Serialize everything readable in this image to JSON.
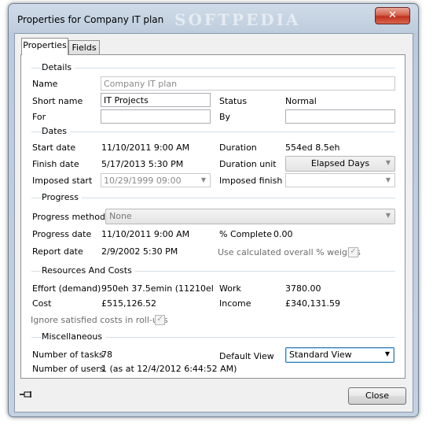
{
  "window": {
    "title": "Properties for Company IT plan",
    "watermark": "SOFTPEDIA",
    "close_glyph": "✕"
  },
  "tabs": [
    {
      "label": "Properties",
      "active": true
    },
    {
      "label": "Fields",
      "active": false
    }
  ],
  "details": {
    "header": "Details",
    "name_label": "Name",
    "name_value": "Company IT plan",
    "short_name_label": "Short name",
    "short_name_value": "IT Projects",
    "status_label": "Status",
    "status_value": "Normal",
    "for_label": "For",
    "for_value": "",
    "by_label": "By",
    "by_value": ""
  },
  "dates": {
    "header": "Dates",
    "start_label": "Start date",
    "start_value": "11/10/2011 9:00 AM",
    "duration_label": "Duration",
    "duration_value": "554ed 8.5eh",
    "finish_label": "Finish date",
    "finish_value": "5/17/2013 5:30 PM",
    "duration_unit_label": "Duration unit",
    "duration_unit_value": "Elapsed Days",
    "imposed_start_label": "Imposed start",
    "imposed_start_value": "10/29/1999 09:00",
    "imposed_finish_label": "Imposed finish",
    "imposed_finish_value": ""
  },
  "progress": {
    "header": "Progress",
    "method_label": "Progress method",
    "method_value": "None",
    "date_label": "Progress date",
    "date_value": "11/10/2011 9:00 AM",
    "complete_label": "% Complete",
    "complete_value": "0.00",
    "report_label": "Report date",
    "report_value": "2/9/2002 5:30 PM",
    "calc_weights_label": "Use calculated overall % weights",
    "calc_weights_checked": true
  },
  "resources": {
    "header": "Resources And Costs",
    "effort_label": "Effort (demand)",
    "effort_value": "950eh 37.5emin (11210el",
    "work_label": "Work",
    "work_value": "3780.00",
    "cost_label": "Cost",
    "cost_value": "£515,126.52",
    "income_label": "Income",
    "income_value": "£340,131.59",
    "ignore_label": "Ignore satisfied costs in roll-ups",
    "ignore_checked": true
  },
  "misc": {
    "header": "Miscellaneous",
    "tasks_label": "Number of tasks",
    "tasks_value": "78",
    "default_view_label": "Default View",
    "default_view_value": "Standard View",
    "users_label": "Number of users",
    "users_value": "1 (as at 12/4/2012 6:44:52 AM)"
  },
  "footer": {
    "close_label": "Close",
    "check_glyph": "✓",
    "arrow_glyph": "▼"
  }
}
